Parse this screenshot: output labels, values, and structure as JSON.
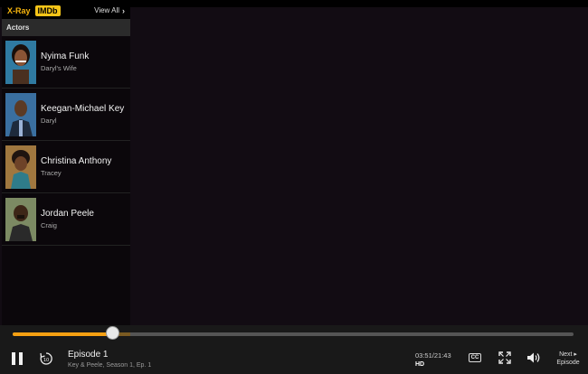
{
  "panel": {
    "xray_label": "X-Ray",
    "imdb_label": "IMDb",
    "view_all": "View All",
    "section": "Actors",
    "actors": [
      {
        "name": "Nyima Funk",
        "role": "Daryl's Wife"
      },
      {
        "name": "Keegan-Michael Key",
        "role": "Daryl"
      },
      {
        "name": "Christina Anthony",
        "role": "Tracey"
      },
      {
        "name": "Jordan Peele",
        "role": "Craig"
      }
    ]
  },
  "player": {
    "episode_title": "Episode 1",
    "episode_subtitle": "Key & Peele, Season 1, Ep. 1",
    "time": "03:51/21:43",
    "quality": "HD",
    "cc_label": "CC",
    "next_line1": "Next ▸",
    "next_line2": "Episode",
    "progress": 0.177,
    "buffered": 0.21
  },
  "icons": {
    "pause": "pause-icon",
    "replay": "replay-10-icon",
    "fullscreen": "fullscreen-icon",
    "volume": "volume-icon",
    "chevron": "chevron-right-icon"
  },
  "colors": {
    "accent": "#f6a012",
    "imdb": "#f5c518"
  }
}
